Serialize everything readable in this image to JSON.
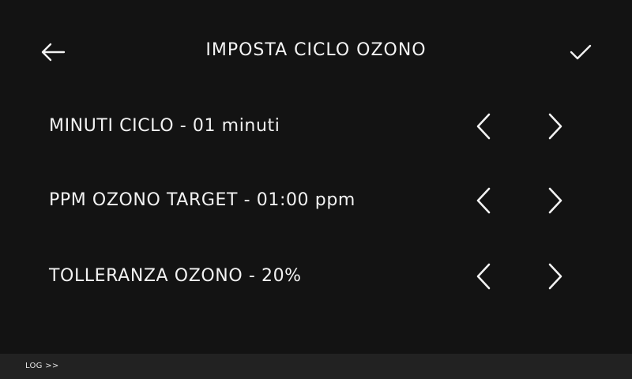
{
  "header": {
    "title": "IMPOSTA CICLO OZONO",
    "back_icon": "arrow-left-icon",
    "confirm_icon": "checkmark-icon"
  },
  "settings": [
    {
      "label": "MINUTI CICLO - 01 minuti",
      "decrease_icon": "chevron-left-icon",
      "increase_icon": "chevron-right-icon"
    },
    {
      "label": "PPM OZONO TARGET - 01:00 ppm",
      "decrease_icon": "chevron-left-icon",
      "increase_icon": "chevron-right-icon"
    },
    {
      "label": "TOLLERANZA OZONO - 20%",
      "decrease_icon": "chevron-left-icon",
      "increase_icon": "chevron-right-icon"
    }
  ],
  "footer": {
    "log_label": "LOG >>"
  },
  "colors": {
    "background": "#131313",
    "footer_background": "#222222",
    "text": "#f2f2f2"
  }
}
